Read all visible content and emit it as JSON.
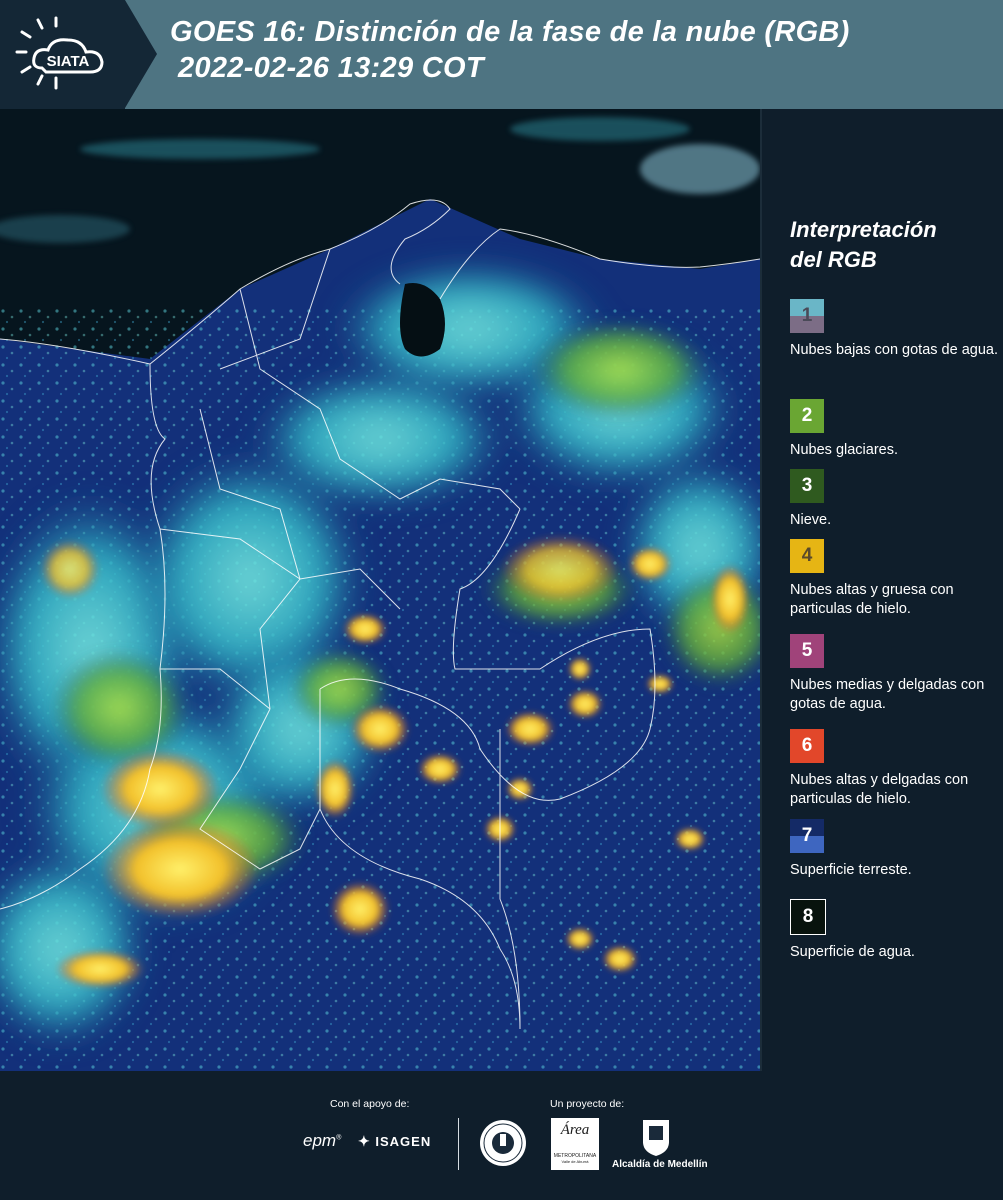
{
  "header": {
    "logo_text": "SIATA",
    "title_line1": "GOES 16: Distinción de la fase de la nube (RGB)",
    "title_line2": "2022-02-26 13:29 COT"
  },
  "legend": {
    "title_line1": "Interpretación",
    "title_line2": "del RGB",
    "items": [
      {
        "num": "1",
        "label": "Nubes bajas con gotas de agua.",
        "color_top": "#6ab6c7",
        "color_bottom": "#7c6d86",
        "num_color": "#4a4a58"
      },
      {
        "num": "2",
        "label": "Nubes glaciares.",
        "color_top": "#6aa633",
        "color_bottom": "#6aa633",
        "num_color": "#ffffff"
      },
      {
        "num": "3",
        "label": "Nieve.",
        "color_top": "#2f5a1f",
        "color_bottom": "#2f5a1f",
        "num_color": "#ffffff"
      },
      {
        "num": "4",
        "label": "Nubes altas y gruesa con particulas de hielo.",
        "color_top": "#e6b514",
        "color_bottom": "#e6b514",
        "num_color": "#5a4a2a"
      },
      {
        "num": "5",
        "label": "Nubes medias y delgadas con gotas de agua.",
        "color_top": "#a0437a",
        "color_bottom": "#a0437a",
        "num_color": "#ffffff"
      },
      {
        "num": "6",
        "label": "Nubes altas y delgadas con particulas de hielo.",
        "color_top": "#e2472a",
        "color_bottom": "#e2472a",
        "num_color": "#ffffff"
      },
      {
        "num": "7",
        "label": "Superficie terreste.",
        "color_top": "#142a66",
        "color_bottom": "#3e66c0",
        "num_color": "#ffffff"
      },
      {
        "num": "8",
        "label": "Superficie de agua.",
        "color_top": "#08130d",
        "color_bottom": "#08130d",
        "num_color": "#ffffff"
      }
    ]
  },
  "footer": {
    "support_label": "Con el apoyo de:",
    "project_label": "Un proyecto de:",
    "epm_text": "epm",
    "isagen_text": "ISAGEN",
    "area_text": "Área",
    "area_sub": "METROPOLITANA",
    "area_sub2": "Valle de Aburrá",
    "alcaldia_text": "Alcaldía de Medellín"
  }
}
